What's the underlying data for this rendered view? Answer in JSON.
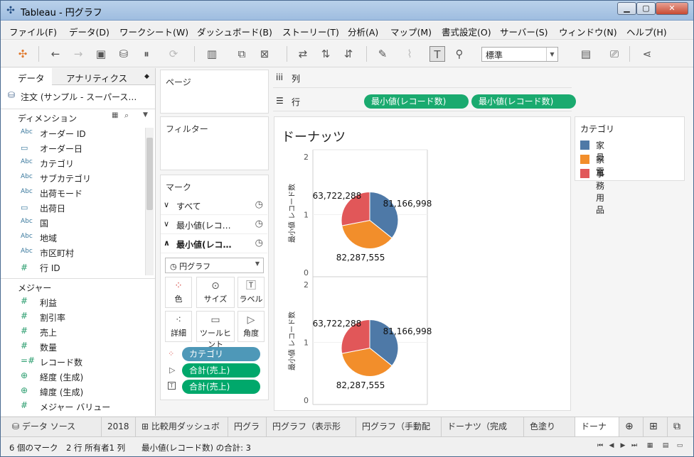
{
  "window": {
    "title": "Tableau - 円グラフ"
  },
  "menu": [
    "ファイル(F)",
    "データ(D)",
    "ワークシート(W)",
    "ダッシュボード(B)",
    "ストーリー(T)",
    "分析(A)",
    "マップ(M)",
    "書式設定(O)",
    "サーバー(S)",
    "ウィンドウ(N)",
    "ヘルプ(H)"
  ],
  "toolbar": {
    "fit_value": "標準"
  },
  "left": {
    "tab_data": "データ",
    "tab_analytics": "アナリティクス",
    "datasource": "注文 (サンプル - スーパース…",
    "dimensions_header": "ディメンション",
    "dimensions": [
      {
        "type": "Abc",
        "label": "オーダー ID"
      },
      {
        "type": "date",
        "label": "オーダー日"
      },
      {
        "type": "Abc",
        "label": "カテゴリ"
      },
      {
        "type": "Abc",
        "label": "サブカテゴリ"
      },
      {
        "type": "Abc",
        "label": "出荷モード"
      },
      {
        "type": "date",
        "label": "出荷日"
      },
      {
        "type": "Abc",
        "label": "国"
      },
      {
        "type": "Abc",
        "label": "地域"
      },
      {
        "type": "Abc",
        "label": "市区町村"
      },
      {
        "type": "#",
        "label": "行 ID"
      }
    ],
    "measures_header": "メジャー",
    "measures": [
      {
        "type": "#",
        "label": "利益"
      },
      {
        "type": "#",
        "label": "割引率"
      },
      {
        "type": "#",
        "label": "売上"
      },
      {
        "type": "#",
        "label": "数量"
      },
      {
        "type": "=#",
        "label": "レコード数"
      },
      {
        "type": "globe",
        "label": "経度 (生成)"
      },
      {
        "type": "globe",
        "label": "緯度 (生成)"
      },
      {
        "type": "#",
        "label": "メジャー バリュー"
      }
    ]
  },
  "mid": {
    "pages": "ページ",
    "filters": "フィルター",
    "marks": "マーク",
    "mark_all": "すべて",
    "mark_1": "最小値(レコ…",
    "mark_2": "最小値(レコ…",
    "mark_type": "円グラフ",
    "btn_color": "色",
    "btn_size": "サイズ",
    "btn_label": "ラベル",
    "btn_detail": "詳細",
    "btn_tooltip": "ツールヒント",
    "btn_angle": "角度",
    "pill_category": "カテゴリ",
    "pill_sum1": "合計(売上)",
    "pill_sum2": "合計(売上)"
  },
  "shelves": {
    "columns": "列",
    "rows": "行",
    "row_pill_1": "最小値(レコード数)",
    "row_pill_2": "最小値(レコード数)"
  },
  "viz": {
    "title": "ドーナッツ",
    "axis_label": "最小値 レコード数",
    "ticks_top": [
      "2",
      "1",
      "0"
    ],
    "ticks_bottom": [
      "2",
      "1",
      "0"
    ]
  },
  "chart_data": [
    {
      "type": "pie",
      "title": "ドーナッツ",
      "categories": [
        "家具",
        "家電",
        "事務用品"
      ],
      "values": [
        81166998,
        82287555,
        63722288
      ],
      "labels": [
        "81,166,998",
        "82,287,555",
        "63,722,288"
      ],
      "ylabel": "最小値 レコード数",
      "ylim": [
        0,
        2
      ]
    },
    {
      "type": "pie",
      "categories": [
        "家具",
        "家電",
        "事務用品"
      ],
      "values": [
        81166998,
        82287555,
        63722288
      ],
      "labels": [
        "81,166,998",
        "82,287,555",
        "63,722,288"
      ],
      "ylabel": "最小値 レコード数",
      "ylim": [
        0,
        2
      ]
    }
  ],
  "legend": {
    "title": "カテゴリ",
    "items": [
      {
        "label": "家具",
        "color": "#4e79a7"
      },
      {
        "label": "家電",
        "color": "#f28e2b"
      },
      {
        "label": "事務用品",
        "color": "#e15759"
      }
    ]
  },
  "bottom_tabs": [
    "データ ソース",
    "2018",
    "比較用ダッシュボード",
    "円グラフ",
    "円グラフ（表示形式）",
    "円グラフ（手動配置）",
    "ドーナツ（完成形）",
    "色塗りMAP",
    "ドーナッツ"
  ],
  "status": {
    "marks": "6 個のマーク",
    "rows": "2 行 所有者1 列",
    "sum": "最小値(レコード数) の合計: 3"
  }
}
